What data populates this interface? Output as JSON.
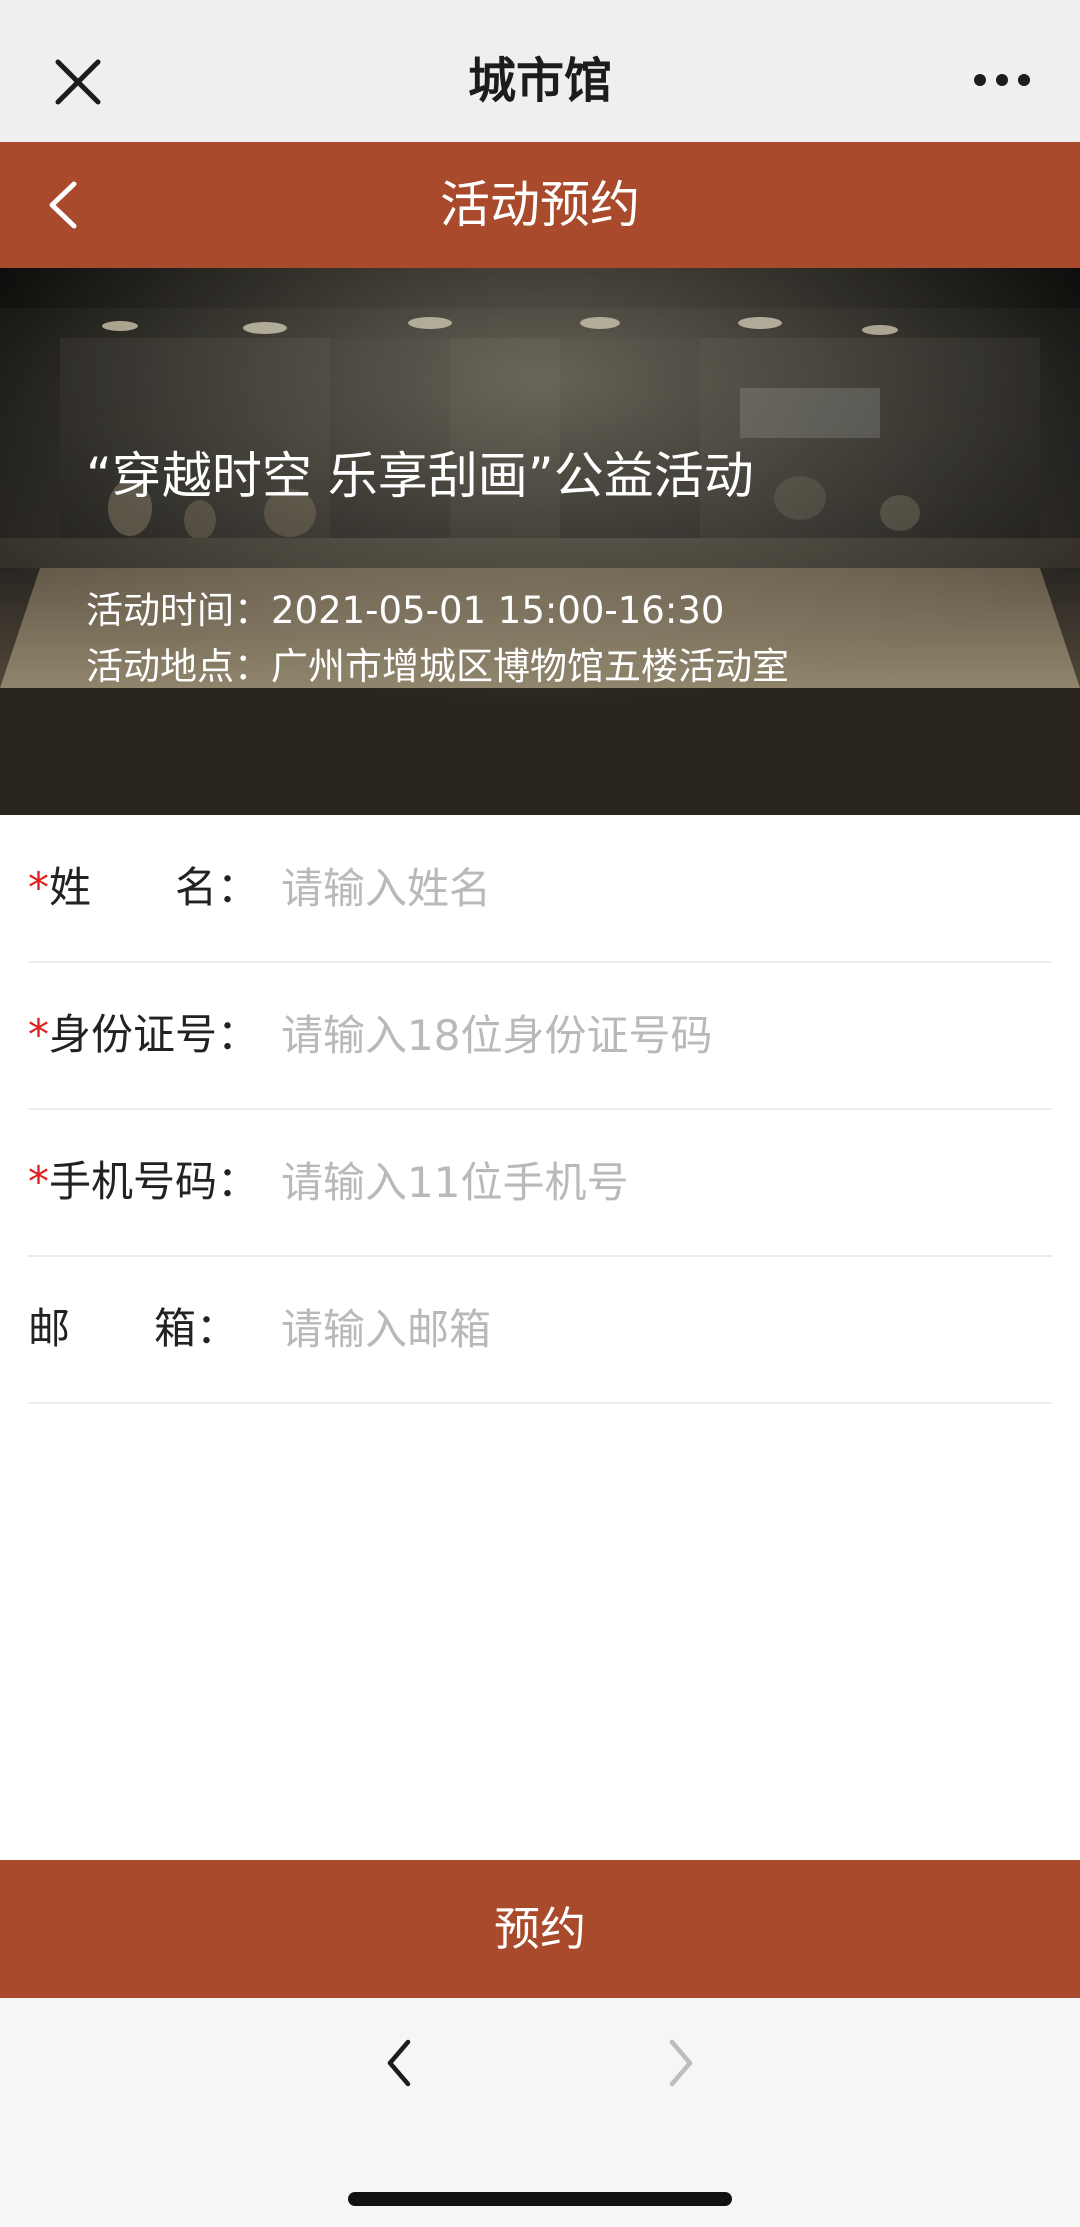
{
  "app": {
    "title": "城市馆"
  },
  "header": {
    "title": "活动预约",
    "background_color": "#a84a2b"
  },
  "hero": {
    "title": "“穿越时空 乐享刮画”公益活动",
    "time_label": "活动时间：",
    "time_value": "2021-05-01 15:00-16:30",
    "place_label": "活动地点：",
    "place_value": "广州市增城区博物馆五楼活动室"
  },
  "form": {
    "fields": [
      {
        "label": "姓　　名：",
        "required": true,
        "placeholder": "请输入姓名",
        "value": ""
      },
      {
        "label": "身份证号：",
        "required": true,
        "placeholder": "请输入18位身份证号码",
        "value": ""
      },
      {
        "label": "手机号码：",
        "required": true,
        "placeholder": "请输入11位手机号",
        "value": ""
      },
      {
        "label": "邮　　箱：",
        "required": false,
        "placeholder": "请输入邮箱",
        "value": ""
      }
    ],
    "required_mark": "*",
    "required_color": "#e02020"
  },
  "submit": {
    "label": "预约"
  },
  "icons": {
    "close": "close-icon",
    "more": "more-icon",
    "back": "chevron-left-icon",
    "forward": "chevron-right-icon"
  }
}
